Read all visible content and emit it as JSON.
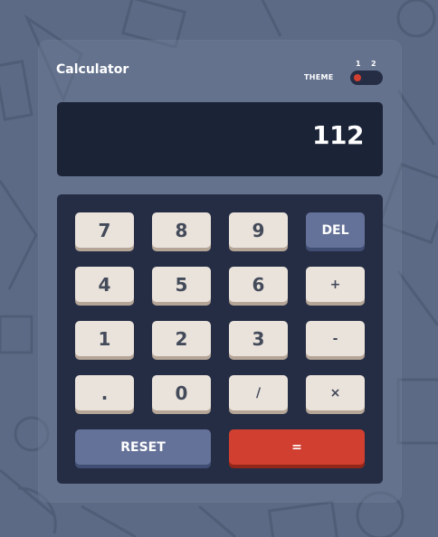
{
  "app": {
    "title": "Calculator"
  },
  "theme": {
    "label": "THEME",
    "options": [
      "1",
      "2"
    ],
    "selected": "1",
    "knob_color": "#d03f2f"
  },
  "display": {
    "value": "112"
  },
  "keys": {
    "row1": [
      "7",
      "8",
      "9",
      "DEL"
    ],
    "row2": [
      "4",
      "5",
      "6",
      "+"
    ],
    "row3": [
      "1",
      "2",
      "3",
      "-"
    ],
    "row4": [
      ".",
      "0",
      "/",
      "×"
    ],
    "reset": "RESET",
    "equals": "="
  },
  "colors": {
    "page_bg": "#5c6a85",
    "screen_bg": "#1b2337",
    "keypad_bg": "#252d44",
    "key_bg": "#eae3dc",
    "key_text": "#434a59",
    "accent_blue": "#647198",
    "accent_red": "#d03f2f"
  }
}
